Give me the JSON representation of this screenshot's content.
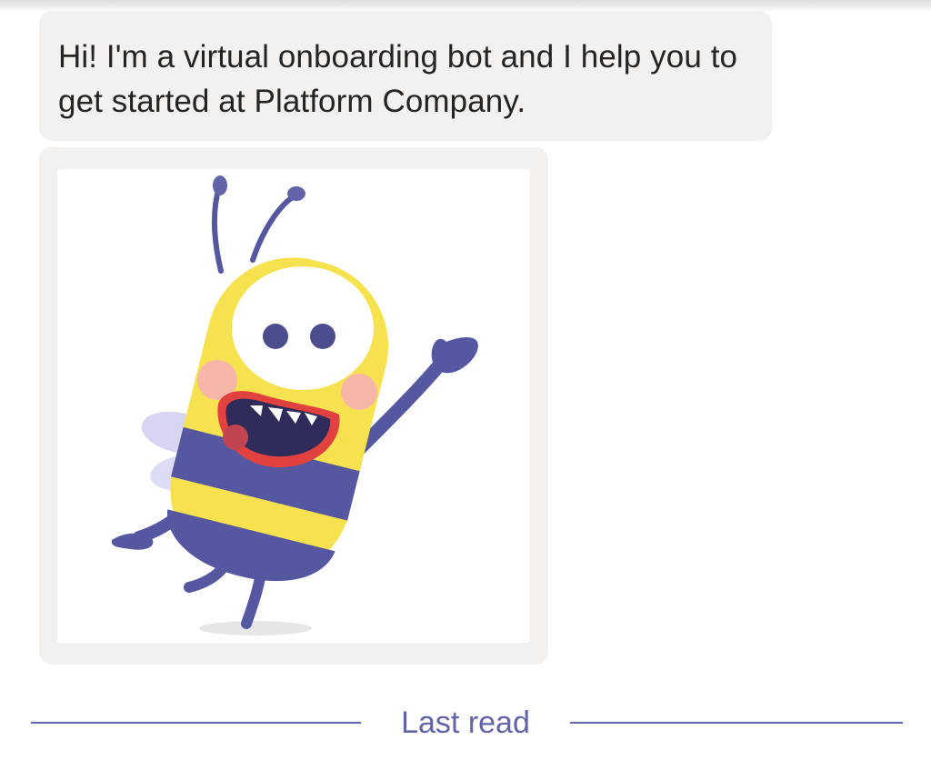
{
  "conversation": {
    "bot_message": {
      "text": "Hi! I'm a virtual onboarding bot and I help you to get started at Platform Company."
    },
    "image_card": {
      "image": "cartoon-bee-waving"
    },
    "last_read_divider": {
      "label": "Last read"
    }
  },
  "colors": {
    "bubble_background": "#f2f1f0",
    "text": "#242424",
    "accent": "#6264a7",
    "bee_yellow": "#f5e24e",
    "bee_purple": "#5558a0"
  }
}
